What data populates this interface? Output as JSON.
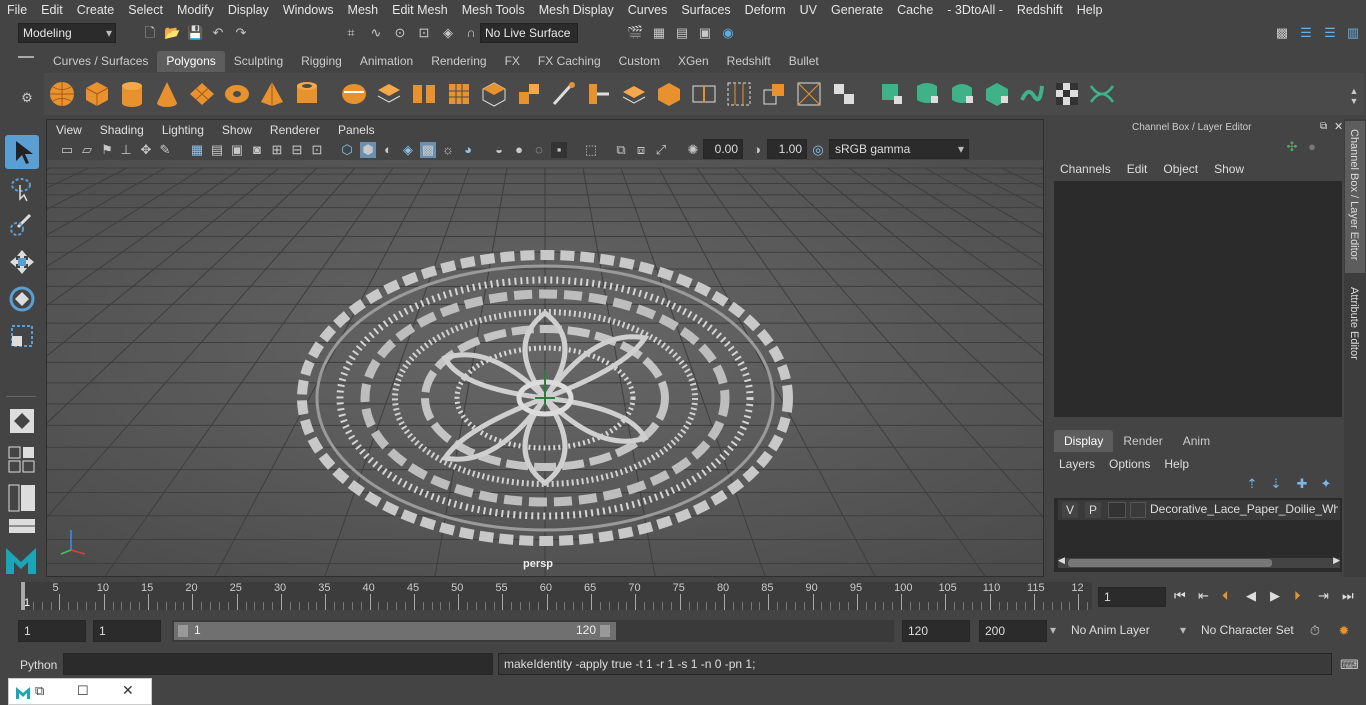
{
  "menu": [
    "File",
    "Edit",
    "Create",
    "Select",
    "Modify",
    "Display",
    "Windows",
    "Mesh",
    "Edit Mesh",
    "Mesh Tools",
    "Mesh Display",
    "Curves",
    "Surfaces",
    "Deform",
    "UV",
    "Generate",
    "Cache",
    "- 3DtoAll -",
    "Redshift",
    "Help"
  ],
  "status": {
    "mode": "Modeling",
    "live_surface": "No Live Surface"
  },
  "shelf_tabs": [
    "Curves / Surfaces",
    "Polygons",
    "Sculpting",
    "Rigging",
    "Animation",
    "Rendering",
    "FX",
    "FX Caching",
    "Custom",
    "XGen",
    "Redshift",
    "Bullet"
  ],
  "shelf_active": "Polygons",
  "viewport": {
    "menu": [
      "View",
      "Shading",
      "Lighting",
      "Show",
      "Renderer",
      "Panels"
    ],
    "exposure": "0.00",
    "gamma": "1.00",
    "color_space": "sRGB gamma",
    "camera_label": "persp"
  },
  "channel_box": {
    "title": "Channel Box / Layer Editor",
    "menu": [
      "Channels",
      "Edit",
      "Object",
      "Show"
    ]
  },
  "layer_editor": {
    "tabs": [
      "Display",
      "Render",
      "Anim"
    ],
    "active_tab": "Display",
    "menu": [
      "Layers",
      "Options",
      "Help"
    ],
    "layer": {
      "v": "V",
      "p": "P",
      "name": "Decorative_Lace_Paper_Doilie_White_"
    }
  },
  "side_tabs": [
    "Channel Box / Layer Editor",
    "Attribute Editor"
  ],
  "timeline": {
    "ticks": [
      "5",
      "10",
      "15",
      "20",
      "25",
      "30",
      "35",
      "40",
      "45",
      "50",
      "55",
      "60",
      "65",
      "70",
      "75",
      "80",
      "85",
      "90",
      "95",
      "100",
      "105",
      "110",
      "115",
      "12"
    ],
    "start_marker": "1",
    "current_frame": "1"
  },
  "range": {
    "start": "1",
    "playback_start": "1",
    "slider_start": "1",
    "slider_end": "120",
    "playback_end": "120",
    "end": "200",
    "anim_layer": "No Anim Layer",
    "character_set": "No Character Set"
  },
  "command": {
    "language": "Python",
    "result": "makeIdentity -apply true -t 1 -r 1 -s 1 -n 0 -pn 1;"
  },
  "colors": {
    "accent": "#5a9fd4",
    "shelf_green": "#3fb28a",
    "bg": "#444444"
  }
}
